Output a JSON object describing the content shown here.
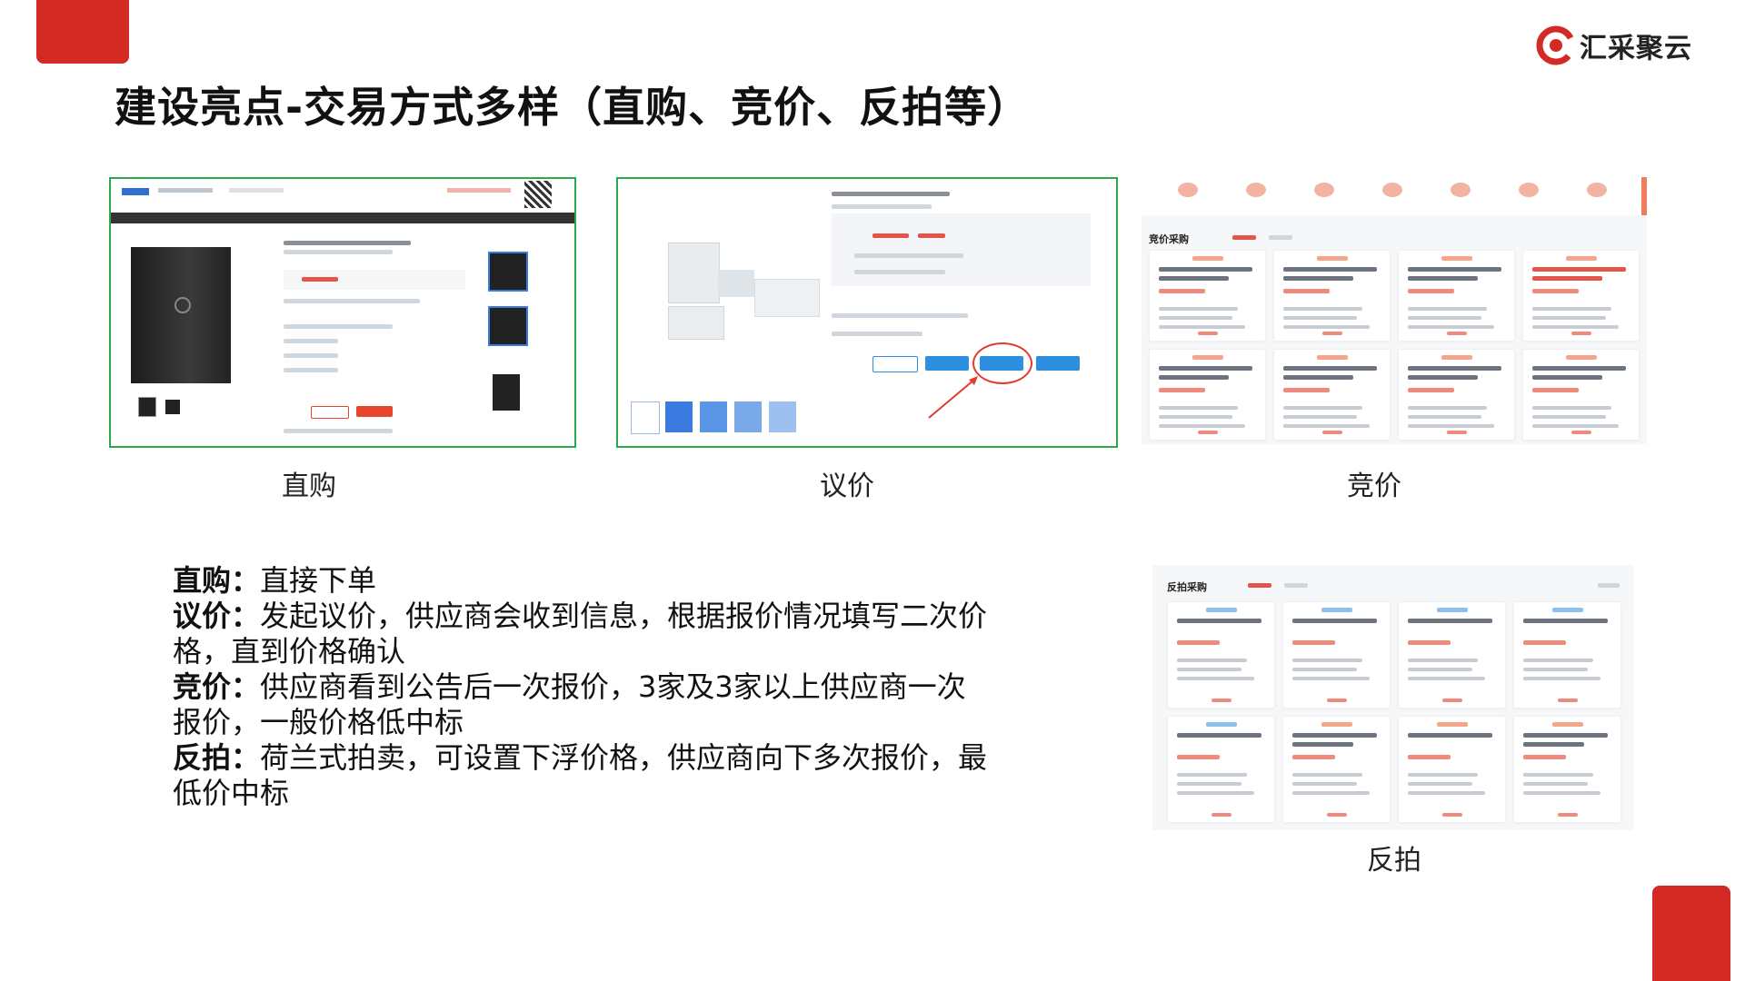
{
  "brand": {
    "logo_text": "汇采聚云",
    "accent": "#d32a26"
  },
  "slide_title": "建设亮点-交易方式多样（直购、竞价、反拍等）",
  "captions": {
    "direct": "直购",
    "negotiate": "议价",
    "bidding": "竞价",
    "reverse": "反拍"
  },
  "screens": {
    "bidding_header": "竞价采购",
    "reverse_header": "反拍采购"
  },
  "descriptions": [
    {
      "term": "直购：",
      "text": "直接下单"
    },
    {
      "term": "议价：",
      "text": "发起议价，供应商会收到信息，根据报价情况填写二次价格，直到价格确认"
    },
    {
      "term": "竞价：",
      "text": "供应商看到公告后一次报价，3家及3家以上供应商一次报价，一般价格低中标"
    },
    {
      "term": "反拍：",
      "text": "荷兰式拍卖，可设置下浮价格，供应商向下多次报价，最低价中标"
    }
  ]
}
